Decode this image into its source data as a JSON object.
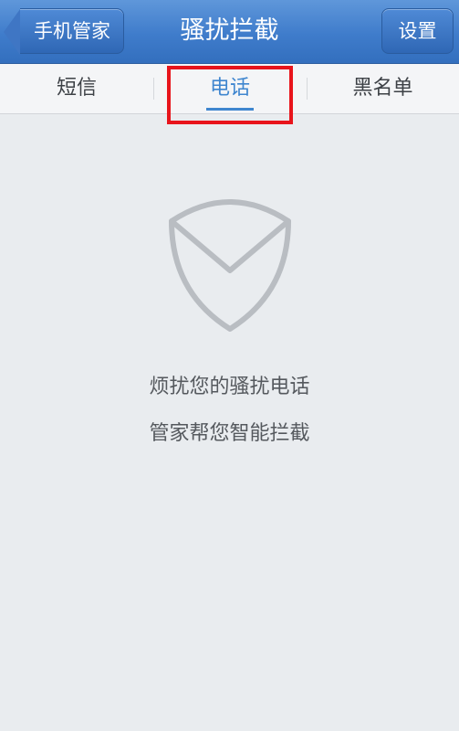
{
  "header": {
    "back_label": "手机管家",
    "title": "骚扰拦截",
    "settings_label": "设置"
  },
  "tabs": [
    {
      "label": "短信"
    },
    {
      "label": "电话",
      "active": true
    },
    {
      "label": "黑名单"
    }
  ],
  "empty_state": {
    "icon": "shield-icon",
    "line1": "烦扰您的骚扰电话",
    "line2": "管家帮您智能拦截"
  },
  "colors": {
    "header_blue": "#3f7ccb",
    "active_tab": "#3f86cf",
    "highlight": "#e8141b",
    "background": "#e9ecef"
  }
}
